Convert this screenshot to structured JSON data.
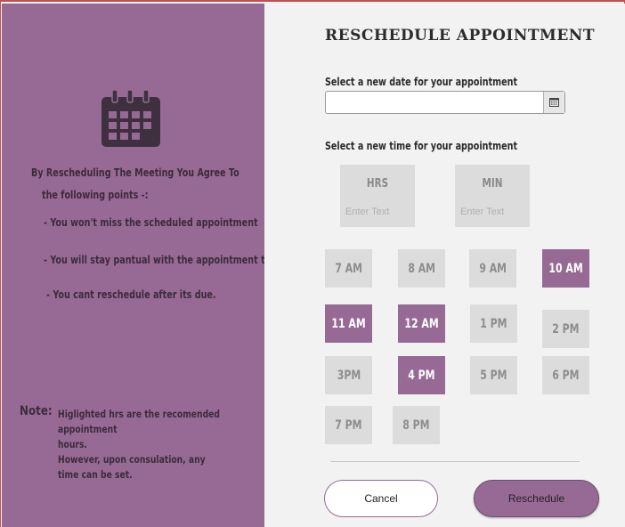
{
  "left": {
    "icon": "calendar-icon",
    "agree_title": "By Rescheduling The Meeting You Agree To",
    "agree_sub": "the following points -:",
    "points": [
      "- You won't miss the scheduled appointment",
      "- You will stay pantual with the appointment times.",
      "- You cant reschedule after its due."
    ],
    "note_label": "Note:",
    "note_lines": [
      "Higlighted hrs are the recomended appointment",
      "hours.",
      "However, upon consulation, any",
      "time can be set."
    ]
  },
  "form": {
    "title": "RESCHEDULE APPOINTMENT",
    "date_label": "Select a new date for your appointment",
    "date_value": "",
    "date_picker_icon": "calendar-grid-icon",
    "time_label": "Select a new time for your appointment",
    "hrs": {
      "label": "HRS",
      "placeholder": "Enter Text"
    },
    "min": {
      "label": "MIN",
      "placeholder": "Enter Text"
    },
    "slots": [
      {
        "label": "7 AM",
        "highlighted": false
      },
      {
        "label": "8 AM",
        "highlighted": false
      },
      {
        "label": "9 AM",
        "highlighted": false
      },
      {
        "label": "10 AM",
        "highlighted": true
      },
      {
        "label": "11 AM",
        "highlighted": true
      },
      {
        "label": "12 AM",
        "highlighted": true
      },
      {
        "label": "1 PM",
        "highlighted": false
      },
      {
        "label": "2 PM",
        "highlighted": false
      },
      {
        "label": "3PM",
        "highlighted": false
      },
      {
        "label": "4 PM",
        "highlighted": true
      },
      {
        "label": "5 PM",
        "highlighted": false
      },
      {
        "label": "6 PM",
        "highlighted": false
      },
      {
        "label": "7 PM",
        "highlighted": false
      },
      {
        "label": "8 PM",
        "highlighted": false
      }
    ],
    "cancel_label": "Cancel",
    "reschedule_label": "Reschedule"
  },
  "colors": {
    "accent": "#976a96",
    "slot_default": "#dcdcdc",
    "background": "#f2f2f2"
  }
}
